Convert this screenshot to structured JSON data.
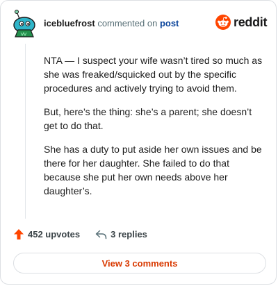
{
  "comment": {
    "username": "icebluefrost",
    "action": "commented on",
    "post_link": "post",
    "paragraphs": [
      "NTA — I suspect your wife wasn’t tired so much as she was freaked/squicked out by the specific procedures and actively trying to avoid them.",
      "But, here’s the thing: she’s a parent; she doesn’t get to do that.",
      "She has a duty to put aside her own issues and be there for her daughter. She failed to do that because she put her own needs above her daughter’s."
    ]
  },
  "brand": {
    "name": "reddit",
    "icon": "reddit-snoo-icon",
    "color": "#ff4500"
  },
  "stats": {
    "upvotes": "452 upvotes",
    "replies": "3 replies",
    "upvote_icon": "upvote-arrow-icon",
    "reply_icon": "reply-arrow-icon",
    "upvote_color": "#ff4500"
  },
  "view_comments_label": "View 3 comments",
  "colors": {
    "link": "#0a449b",
    "accent": "#d93900"
  }
}
